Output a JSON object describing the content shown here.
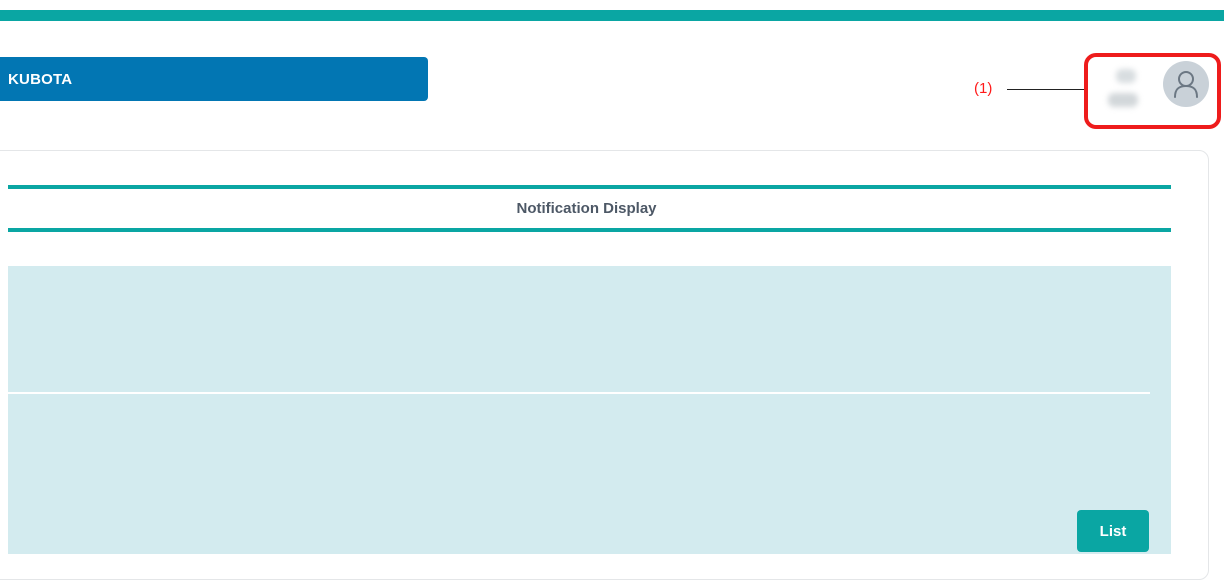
{
  "header": {
    "brand": "KUBOTA"
  },
  "annotation": {
    "callout_label": "(1)",
    "highlight_color": "#ee1c1c"
  },
  "user": {
    "avatar_icon": "user-icon"
  },
  "notification": {
    "title": "Notification Display",
    "list_button_label": "List"
  },
  "colors": {
    "accent": "#0aa6a3",
    "brand_bar": "#0276b3",
    "content_background": "#d3ebef",
    "avatar_background": "#c9d1d8"
  }
}
